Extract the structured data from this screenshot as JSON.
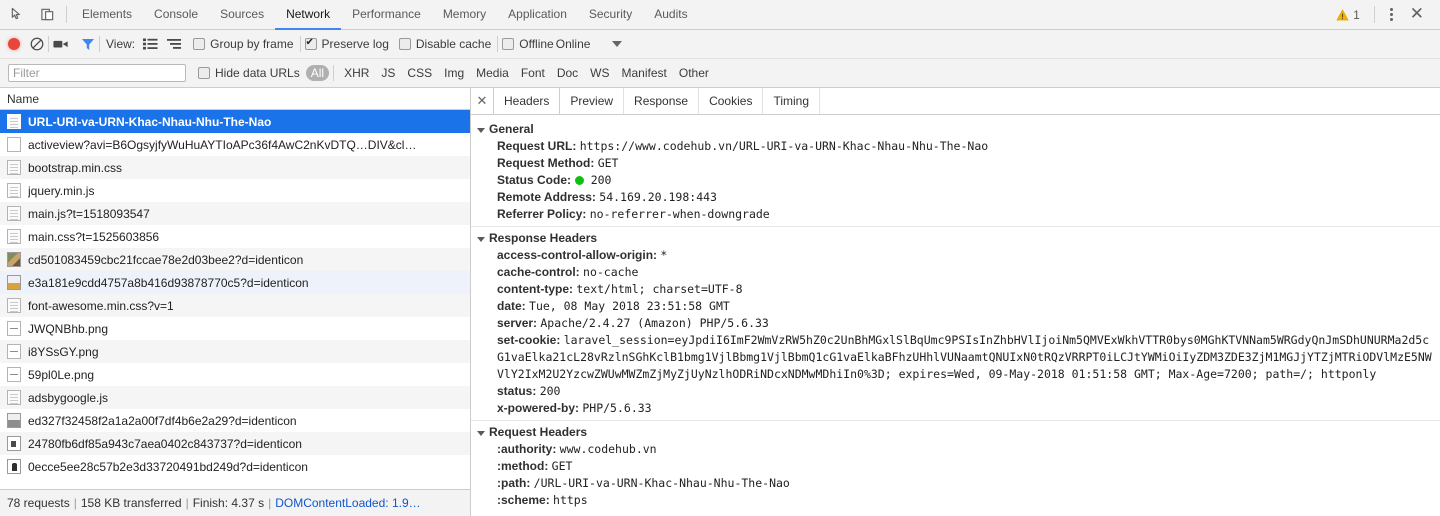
{
  "window": {
    "tabs": [
      {
        "label": "Elements",
        "active": false
      },
      {
        "label": "Console",
        "active": false
      },
      {
        "label": "Sources",
        "active": false
      },
      {
        "label": "Network",
        "active": true
      },
      {
        "label": "Performance",
        "active": false
      },
      {
        "label": "Memory",
        "active": false
      },
      {
        "label": "Application",
        "active": false
      },
      {
        "label": "Security",
        "active": false
      },
      {
        "label": "Audits",
        "active": false
      }
    ],
    "warning_count": "1",
    "inspect_icon": "inspect-element-icon",
    "device_icon": "device-toolbar-icon",
    "menu_icon": "more-options-icon",
    "close_icon": "close-icon"
  },
  "toolbar": {
    "record_title": "record-button",
    "clear_title": "clear-button",
    "screenshot_title": "capture-screenshots-icon",
    "filter_title": "filter-icon",
    "view_label": "View:",
    "view_list_icon": "list-view-icon",
    "view_waterfall_icon": "waterfall-view-icon",
    "group_by_frame": {
      "label": "Group by frame",
      "checked": false
    },
    "preserve_log": {
      "label": "Preserve log",
      "checked": true
    },
    "disable_cache": {
      "label": "Disable cache",
      "checked": false
    },
    "offline": {
      "label": "Offline",
      "checked": false
    },
    "online_label": "Online",
    "throttle_caret": "chevron-down-icon"
  },
  "filterbar": {
    "placeholder": "Filter",
    "value": "",
    "hide_data_urls": {
      "label": "Hide data URLs",
      "checked": false
    },
    "types": [
      {
        "label": "All",
        "selected": true
      },
      {
        "label": "XHR",
        "selected": false
      },
      {
        "label": "JS",
        "selected": false
      },
      {
        "label": "CSS",
        "selected": false
      },
      {
        "label": "Img",
        "selected": false
      },
      {
        "label": "Media",
        "selected": false
      },
      {
        "label": "Font",
        "selected": false
      },
      {
        "label": "Doc",
        "selected": false
      },
      {
        "label": "WS",
        "selected": false
      },
      {
        "label": "Manifest",
        "selected": false
      },
      {
        "label": "Other",
        "selected": false
      }
    ]
  },
  "requests": {
    "column_header": "Name",
    "rows": [
      {
        "name": "URL-URI-va-URN-Khac-Nhau-Nhu-The-Nao",
        "icon": "doc",
        "state": "selected"
      },
      {
        "name": "activeview?avi=B6OgsyjfyWuHuAYTIoAPc36f4AwC2nKvDTQ…DIV&cl…",
        "icon": "blank",
        "state": "normal"
      },
      {
        "name": "bootstrap.min.css",
        "icon": "doc",
        "state": "odd"
      },
      {
        "name": "jquery.min.js",
        "icon": "doc",
        "state": "normal"
      },
      {
        "name": "main.js?t=1518093547",
        "icon": "doc",
        "state": "odd"
      },
      {
        "name": "main.css?t=1525603856",
        "icon": "doc",
        "state": "normal"
      },
      {
        "name": "cd501083459cbc21fccae78e2d03bee2?d=identicon",
        "icon": "img1",
        "state": "odd"
      },
      {
        "name": "e3a181e9cdd4757a8b416d93878770c5?d=identicon",
        "icon": "img2",
        "state": "highlight"
      },
      {
        "name": "font-awesome.min.css?v=1",
        "icon": "doc",
        "state": "odd"
      },
      {
        "name": "JWQNBhb.png",
        "icon": "dash",
        "state": "normal"
      },
      {
        "name": "i8YSsGY.png",
        "icon": "dash",
        "state": "odd"
      },
      {
        "name": "59pl0Le.png",
        "icon": "dash",
        "state": "normal"
      },
      {
        "name": "adsbygoogle.js",
        "icon": "doc",
        "state": "odd"
      },
      {
        "name": "ed327f32458f2a1a2a00f7df4b6e2a29?d=identicon",
        "icon": "img3",
        "state": "normal"
      },
      {
        "name": "24780fb6df85a943c7aea0402c843737?d=identicon",
        "icon": "img4",
        "state": "odd"
      },
      {
        "name": "0ecce5ee28c57b2e3d33720491bd249d?d=identicon",
        "icon": "img5",
        "state": "normal"
      }
    ]
  },
  "statusbar": {
    "requests": "78 requests",
    "transferred": "158 KB transferred",
    "finish": "Finish: 4.37 s",
    "dcl": "DOMContentLoaded: 1.9…",
    "separator": "|"
  },
  "details": {
    "close_icon": "close-icon",
    "tabs": [
      {
        "label": "Headers",
        "active": true
      },
      {
        "label": "Preview",
        "active": false
      },
      {
        "label": "Response",
        "active": false
      },
      {
        "label": "Cookies",
        "active": false
      },
      {
        "label": "Timing",
        "active": false
      }
    ],
    "general": {
      "title": "General",
      "rows": [
        {
          "key": "Request URL:",
          "value": "https://www.codehub.vn/URL-URI-va-URN-Khac-Nhau-Nhu-The-Nao"
        },
        {
          "key": "Request Method:",
          "value": "GET"
        },
        {
          "key": "Status Code:",
          "value": "200",
          "dot": "#10c010"
        },
        {
          "key": "Remote Address:",
          "value": "54.169.20.198:443"
        },
        {
          "key": "Referrer Policy:",
          "value": "no-referrer-when-downgrade"
        }
      ]
    },
    "response_headers": {
      "title": "Response Headers",
      "rows": [
        {
          "key": "access-control-allow-origin:",
          "value": "*"
        },
        {
          "key": "cache-control:",
          "value": "no-cache"
        },
        {
          "key": "content-type:",
          "value": "text/html; charset=UTF-8"
        },
        {
          "key": "date:",
          "value": "Tue, 08 May 2018 23:51:58 GMT"
        },
        {
          "key": "server:",
          "value": "Apache/2.4.27 (Amazon) PHP/5.6.33"
        },
        {
          "key": "set-cookie:",
          "value": "laravel_session=eyJpdiI6ImF2WmVzRW5hZ0c2UnBhMGxlSlBqUmc9PSIsInZhbHVlIjoiNm5QMVExWkhVTTR0bys0MGhKTVNNam5WRGdyQnJmSDhUNURMa2d5cG1vaElka21cL28vRzlnSGhKclB1bmg1VjlBbmg1VjlBbmQ1cG1vaElkaBFhzUHhlVUNaamtQNUIxN0tRQzVRRPT0iLCJtYWMiOiIyZDM3ZDE3ZjM1MGJjYTZjMTRiODVlMzE5NWVlY2IxM2U2YzcwZWUwMWZmZjMyZjUyNzlhODRiNDcxNDMwMDhiIn0%3D; expires=Wed, 09-May-2018 01:51:58 GMT; Max-Age=7200; path=/; httponly"
        },
        {
          "key": "status:",
          "value": "200"
        },
        {
          "key": "x-powered-by:",
          "value": "PHP/5.6.33"
        }
      ]
    },
    "request_headers": {
      "title": "Request Headers",
      "rows": [
        {
          "key": ":authority:",
          "value": "www.codehub.vn"
        },
        {
          "key": ":method:",
          "value": "GET"
        },
        {
          "key": ":path:",
          "value": "/URL-URI-va-URN-Khac-Nhau-Nhu-The-Nao"
        },
        {
          "key": ":scheme:",
          "value": "https"
        }
      ]
    }
  },
  "colors": {
    "accent": "#4285f4",
    "selection": "#1a73e8",
    "record": "#e8453c",
    "status_ok": "#10c010",
    "link": "#1155cc"
  }
}
